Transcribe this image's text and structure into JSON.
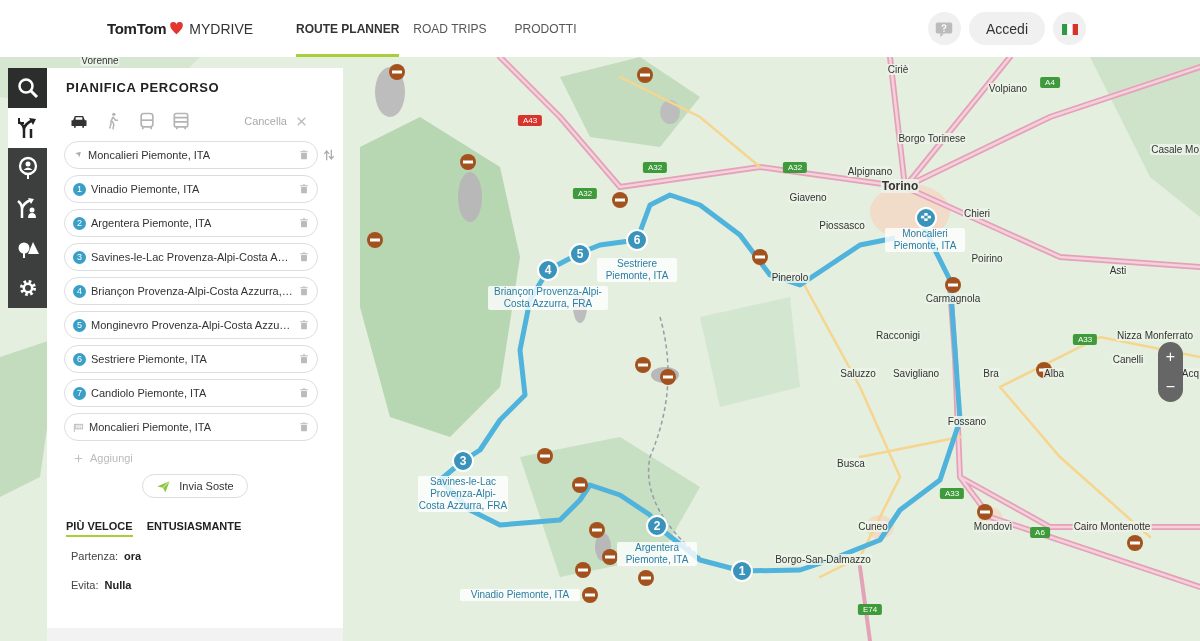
{
  "header": {
    "logo": "TomTom",
    "product": "MYDRIVE",
    "nav": [
      {
        "label": "ROUTE PLANNER",
        "selected": true
      },
      {
        "label": "ROAD TRIPS",
        "selected": false
      },
      {
        "label": "PRODOTTI",
        "selected": false
      }
    ],
    "login_button": "Accedi"
  },
  "side_bar": {
    "items": [
      {
        "kind": "search",
        "selected": false
      },
      {
        "kind": "route",
        "selected": true
      },
      {
        "kind": "places",
        "selected": false
      },
      {
        "kind": "trips",
        "selected": false
      },
      {
        "kind": "nature",
        "selected": false
      },
      {
        "kind": "settings",
        "selected": false
      }
    ]
  },
  "planner": {
    "title": "PIANIFICA PERCORSO",
    "modes": [
      {
        "kind": "car",
        "selected": true
      },
      {
        "kind": "walk",
        "selected": false
      },
      {
        "kind": "bus",
        "selected": false
      },
      {
        "kind": "coach",
        "selected": false
      }
    ],
    "clear": "Cancella",
    "stops": [
      {
        "kind": "start",
        "text": "Moncalieri Piemonte, ITA"
      },
      {
        "kind": "stop",
        "number": "1",
        "text": "Vinadio Piemonte, ITA"
      },
      {
        "kind": "stop",
        "number": "2",
        "text": "Argentera Piemonte, ITA"
      },
      {
        "kind": "stop",
        "number": "3",
        "text": "Savines-le-Lac Provenza-Alpi-Costa A…"
      },
      {
        "kind": "stop",
        "number": "4",
        "text": "Briançon Provenza-Alpi-Costa Azzurra,…"
      },
      {
        "kind": "stop",
        "number": "5",
        "text": "Monginevro Provenza-Alpi-Costa Azzu…"
      },
      {
        "kind": "stop",
        "number": "6",
        "text": "Sestriere Piemonte, ITA"
      },
      {
        "kind": "stop",
        "number": "7",
        "text": "Candiolo Piemonte, ITA"
      },
      {
        "kind": "end",
        "text": "Moncalieri Piemonte, ITA"
      }
    ],
    "add": "Aggiungi",
    "send_button": "Invia Soste",
    "route_types": [
      {
        "label": "PIÙ VELOCE",
        "selected": true
      },
      {
        "label": "ENTUSIASMANTE",
        "selected": false
      }
    ],
    "options": [
      {
        "label": "Partenza:",
        "value": "ora"
      },
      {
        "label": "Evita:",
        "value": "Nulla"
      }
    ]
  },
  "map": {
    "place_labels": [
      "Vorenne",
      "Ciriè",
      "Volpiano",
      "Borgo Torinese",
      "Casale Mo",
      "Alpignano",
      "Torino",
      "Giaveno",
      "Chieri",
      "Piossasco",
      "Poirino",
      "Asti",
      "Pinerolo",
      "Carmagnola",
      "Racconigi",
      "Nizza Monferrato",
      "Canelli",
      "Saluzzo",
      "Savigliano",
      "Bra",
      "Alba",
      "Acq",
      "Fossano",
      "Busca",
      "Cuneo",
      "Mondovì",
      "Cairo Montenotte",
      "Borgo-San-Dalmazzo"
    ],
    "road_shields": [
      {
        "text": "A43",
        "color": "#d9342b"
      },
      {
        "text": "A32",
        "color": "#3e9a3a"
      },
      {
        "text": "A32",
        "color": "#3e9a3a"
      },
      {
        "text": "A32",
        "color": "#3e9a3a"
      },
      {
        "text": "A4",
        "color": "#3e9a3a"
      },
      {
        "text": "A33",
        "color": "#3e9a3a"
      },
      {
        "text": "A33",
        "color": "#3e9a3a"
      },
      {
        "text": "A6",
        "color": "#3e9a3a"
      },
      {
        "text": "E74",
        "color": "#3e9a3a"
      }
    ],
    "route_markers": [
      {
        "number": "1",
        "label": "Vinadio Piemonte, ITA"
      },
      {
        "number": "2",
        "label": "Argentera Piemonte, ITA"
      },
      {
        "number": "3",
        "label": "Savines-le-Lac Provenza-Alpi-Costa Azzurra, FRA"
      },
      {
        "number": "4",
        "label": "Briançon Provenza-Alpi-Costa Azzurra, FRA"
      },
      {
        "number": "5"
      },
      {
        "number": "6",
        "label": "Sestriere Piemonte, ITA"
      }
    ],
    "destination_label": "Moncalieri Piemonte, ITA",
    "zoom": {
      "in": "+",
      "out": "−"
    }
  }
}
